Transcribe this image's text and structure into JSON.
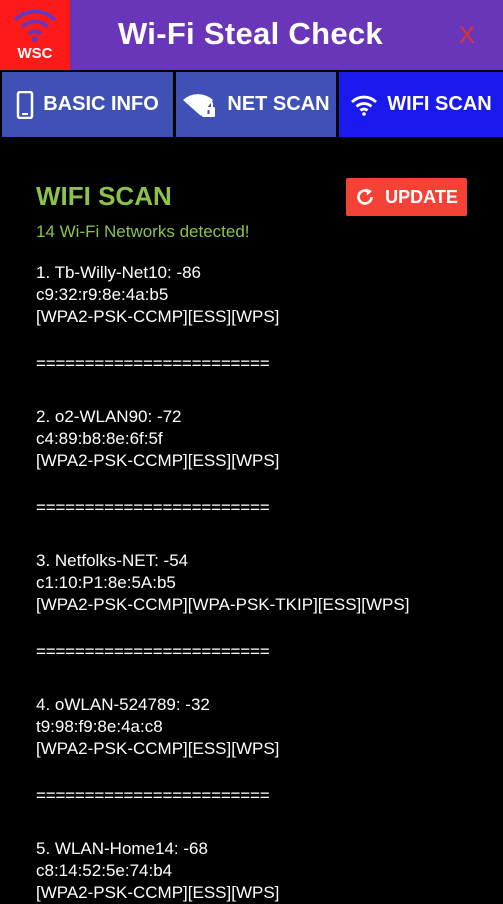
{
  "app": {
    "logo_text": "WSC",
    "title": "Wi-Fi Steal Check",
    "close_label": "X"
  },
  "tabs": [
    {
      "label": "BASIC INFO",
      "icon": "phone-icon"
    },
    {
      "label": "NET SCAN",
      "icon": "wifi-lock-icon"
    },
    {
      "label": "WIFI SCAN",
      "icon": "wifi-icon",
      "active": true
    }
  ],
  "scan": {
    "title": "WIFI SCAN",
    "update_label": "UPDATE",
    "detected_text": "14 Wi-Fi Networks detected!",
    "separator": "========================",
    "networks": [
      {
        "line1": "1. Tb-Willy-Net10: -86",
        "mac": "c9:32:r9:8e:4a:b5",
        "flags": "[WPA2-PSK-CCMP][ESS][WPS]"
      },
      {
        "line1": "2. o2-WLAN90: -72",
        "mac": "c4:89:b8:8e:6f:5f",
        "flags": "[WPA2-PSK-CCMP][ESS][WPS]"
      },
      {
        "line1": "3. Netfolks-NET: -54",
        "mac": "c1:10:P1:8e:5A:b5",
        "flags": "[WPA2-PSK-CCMP][WPA-PSK-TKIP][ESS][WPS]"
      },
      {
        "line1": "4. oWLAN-524789: -32",
        "mac": "t9:98:f9:8e:4a:c8",
        "flags": "[WPA2-PSK-CCMP][ESS][WPS]"
      },
      {
        "line1": "5. WLAN-Home14: -68",
        "mac": "c8:14:52:5e:74:b4",
        "flags": "[WPA2-PSK-CCMP][ESS][WPS]"
      }
    ]
  },
  "colors": {
    "appbar": "#6a36b9",
    "logo_bg": "#ff1a1a",
    "tab_bg": "#3f51b5",
    "tab_active_bg": "#1a1aee",
    "accent_green": "#8bc34a",
    "update_red": "#f44336"
  }
}
